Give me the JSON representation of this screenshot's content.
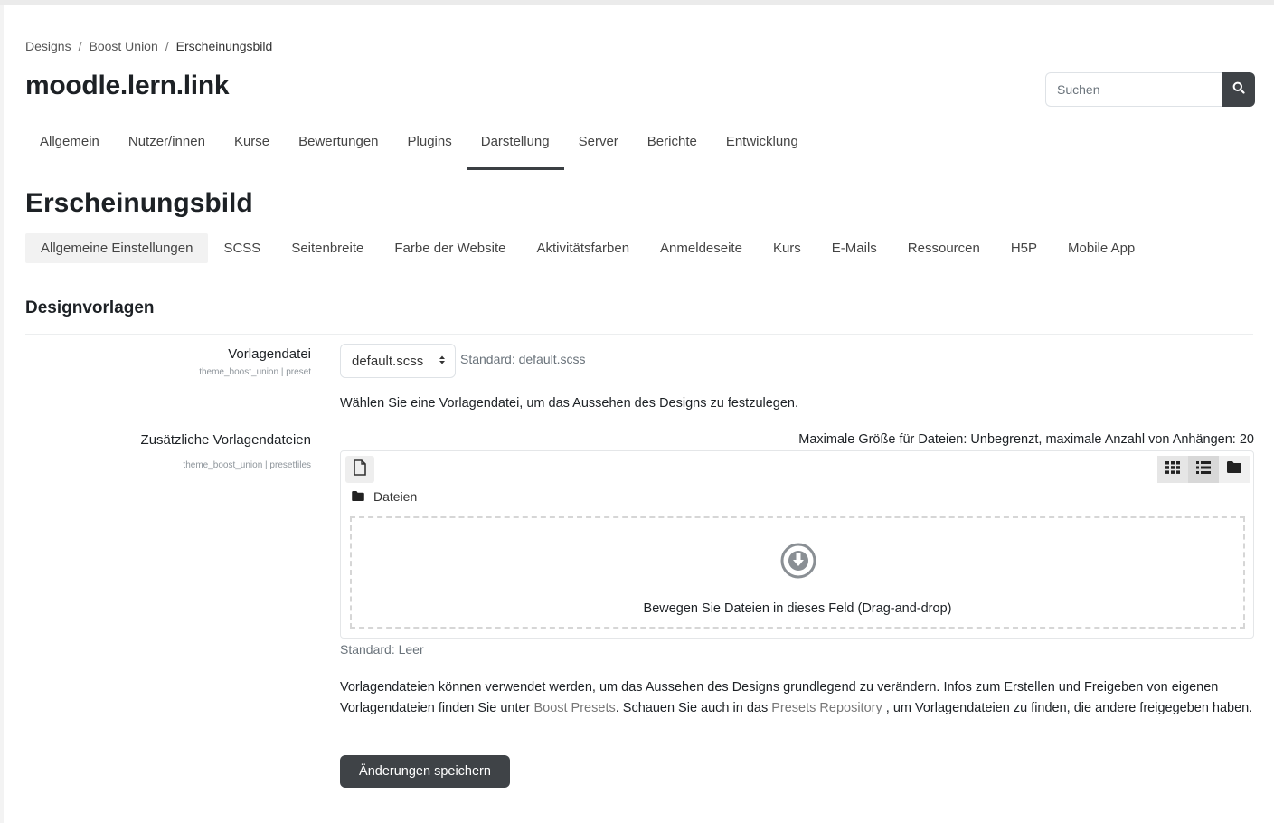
{
  "breadcrumb": {
    "items": [
      "Designs",
      "Boost Union",
      "Erscheinungsbild"
    ],
    "separator": "/"
  },
  "site": {
    "title": "moodle.lern.link"
  },
  "search": {
    "placeholder": "Suchen",
    "icon": "search-icon"
  },
  "primary_nav": {
    "items": [
      "Allgemein",
      "Nutzer/innen",
      "Kurse",
      "Bewertungen",
      "Plugins",
      "Darstellung",
      "Server",
      "Berichte",
      "Entwicklung"
    ],
    "active": "Darstellung"
  },
  "page": {
    "title": "Erscheinungsbild"
  },
  "secondary_nav": {
    "items": [
      "Allgemeine Einstellungen",
      "SCSS",
      "Seitenbreite",
      "Farbe der Website",
      "Aktivitätsfarben",
      "Anmeldeseite",
      "Kurs",
      "E-Mails",
      "Ressourcen",
      "H5P",
      "Mobile App"
    ],
    "active": "Allgemeine Einstellungen"
  },
  "section": {
    "title": "Designvorlagen"
  },
  "preset": {
    "label": "Vorlagendatei",
    "setting_id": "theme_boost_union | preset",
    "selected": "default.scss",
    "default_note": "Standard: default.scss",
    "description": "Wählen Sie eine Vorlagendatei, um das Aussehen des Designs zu festzulegen."
  },
  "presetfiles": {
    "label": "Zusätzliche Vorlagendateien",
    "setting_id": "theme_boost_union | presetfiles",
    "max_size_note": "Maximale Größe für Dateien: Unbegrenzt, maximale Anzahl von Anhängen: 20",
    "folder_label": "Dateien",
    "dropzone_text": "Bewegen Sie Dateien in dieses Feld (Drag-and-drop)",
    "default_note": "Standard: Leer"
  },
  "description": {
    "part1": "Vorlagendateien können verwendet werden, um das Aussehen des Designs grundlegend zu verändern. Infos zum Erstellen und Freigeben von eigenen Vorlagendateien finden Sie unter ",
    "link1": "Boost Presets",
    "part2": ". Schauen Sie auch in das ",
    "link2": "Presets Repository",
    "part3": " , um Vorlagendateien zu finden, die andere freigegeben haben."
  },
  "actions": {
    "save_label": "Änderungen speichern"
  },
  "colors": {
    "dark_button": "#3f4347",
    "text": "#1d2125",
    "muted": "#6a737b"
  }
}
